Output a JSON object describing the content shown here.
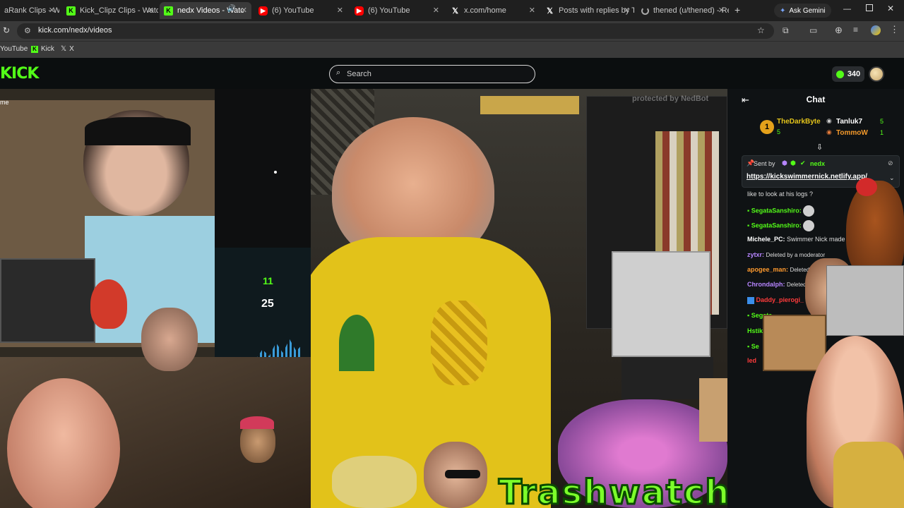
{
  "browser": {
    "tabs": [
      {
        "label": "aRank Clips - Wa",
        "icon": "kick-favicon"
      },
      {
        "label": "Kick_Clipz Clips - Watc",
        "icon": "kick-favicon"
      },
      {
        "label": "nedx Videos - Watc",
        "icon": "kick-favicon",
        "active": true
      },
      {
        "label": "(6) YouTube",
        "icon": "youtube-favicon"
      },
      {
        "label": "(6) YouTube",
        "icon": "youtube-favicon"
      },
      {
        "label": "x.com/home",
        "icon": "x-favicon"
      },
      {
        "label": "Posts with replies by Tr",
        "icon": "x-favicon"
      },
      {
        "label": "thened (u/thened) - Re",
        "icon": "loading-spinner"
      }
    ],
    "ask_gemini": "Ask Gemini",
    "url": "kick.com/nedx/videos",
    "bookmarks": [
      "YouTube",
      "Kick",
      "X"
    ]
  },
  "kick": {
    "logo": "KICK",
    "search_placeholder": "Search",
    "points": "340"
  },
  "video": {
    "overlay_text": "protected by NedBot",
    "corner_label": "me",
    "stat_top": "11",
    "stat_bottom": "25",
    "banner": "Trashwatch"
  },
  "chat": {
    "title": "Chat",
    "leaderboard": [
      {
        "rank": "1",
        "name": "TheDarkByte",
        "count": "5"
      },
      {
        "name": "Tanluk7",
        "count": "5"
      },
      {
        "name": "TommoW",
        "count": "1"
      }
    ],
    "pinned": {
      "sent_by_label": "Sent by",
      "sender": "nedx",
      "link": "https://kickswimmernick.netlify.app/"
    },
    "messages": [
      {
        "user": "",
        "text": "like to look at his logs ?"
      },
      {
        "user": "SegataSanshiro:",
        "text": ""
      },
      {
        "user": "SegataSanshiro:",
        "text": ""
      },
      {
        "user": "Michele_PC:",
        "text": "Swimmer Nick made"
      },
      {
        "user": "zytxr:",
        "text": "Deleted by a moderator"
      },
      {
        "user": "apogee_man:",
        "text": "Deleted by a moderator"
      },
      {
        "user": "Chrondalph:",
        "text": "Deleted"
      },
      {
        "user": "Daddy_pierogi_",
        "text": ""
      },
      {
        "user": "Segata",
        "text": ""
      },
      {
        "user": "Hstikl",
        "text": ""
      },
      {
        "user": "Se",
        "text": ""
      },
      {
        "user": "led",
        "text": ""
      }
    ]
  },
  "colors": {
    "kick_green": "#53fc18",
    "chat_bg": "#0f1214"
  }
}
